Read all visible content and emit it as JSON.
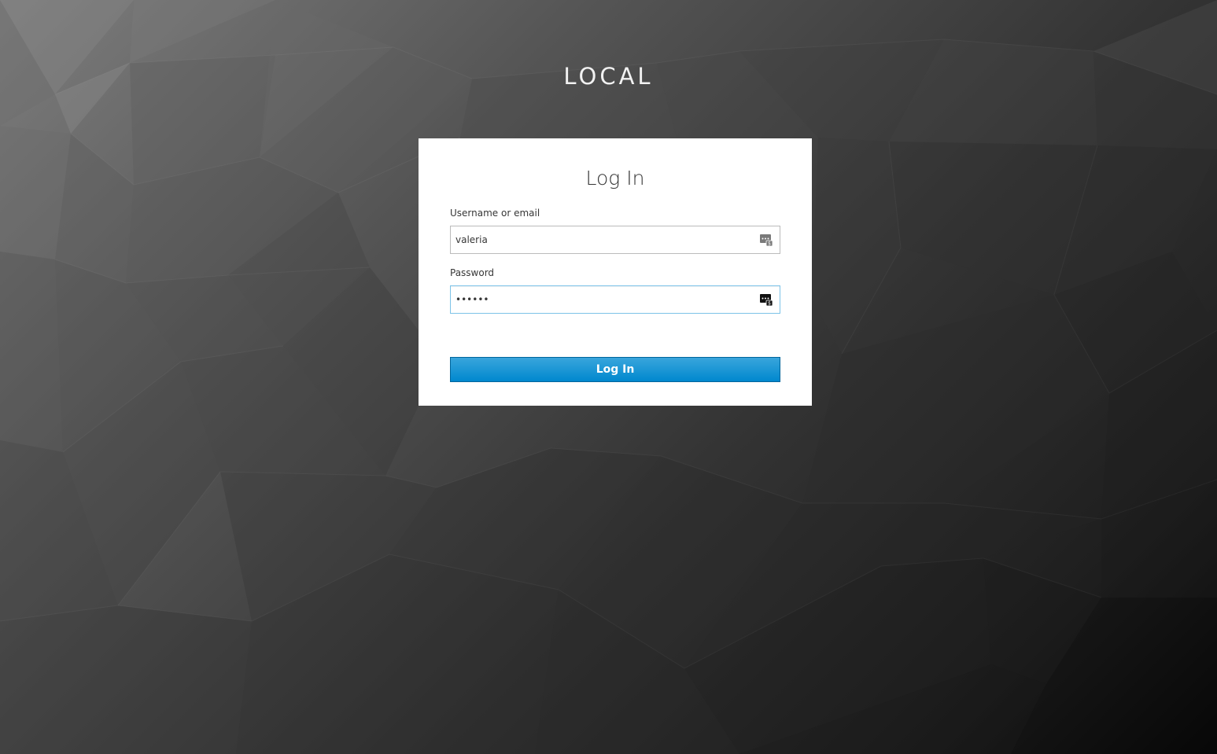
{
  "realm": {
    "title": "LOCAL"
  },
  "login_form": {
    "heading": "Log In",
    "username": {
      "label": "Username or email",
      "value": "valeria"
    },
    "password": {
      "label": "Password",
      "value": "secret"
    },
    "submit_label": "Log In",
    "icons": {
      "username_field_icon": "password-manager-icon",
      "password_field_icon": "password-manager-icon"
    }
  },
  "colors": {
    "button_primary": "#0088ce",
    "button_border": "#00659c",
    "card_background": "#ffffff",
    "realm_title": "#f2f2f2"
  }
}
